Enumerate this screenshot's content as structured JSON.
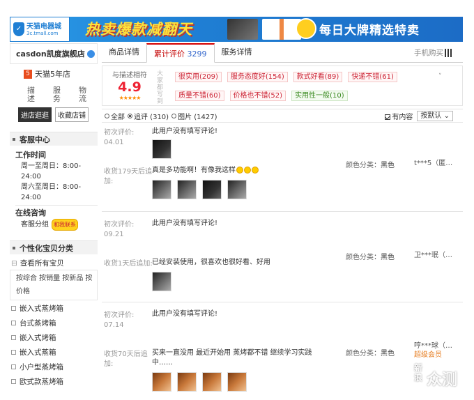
{
  "banner": {
    "logo_text": "天猫电器城",
    "logo_sub": "3c.tmall.com",
    "slogan": "热卖爆款减翻天",
    "right_text": "每日大牌精选特卖"
  },
  "sidebar": {
    "shop_name": "casdon凯度旗舰店",
    "years_badge": "5",
    "years_text": "天猫5年店",
    "ratings": [
      "描述",
      "服务",
      "物流"
    ],
    "btn_enter": "进店逛逛",
    "btn_fav": "收藏店铺",
    "service_header": "客服中心",
    "work_time_title": "工作时间",
    "weekday_hours": "周一至周日：8:00-24:00",
    "weekend_hours": "周六至周日：8:00-24:00",
    "online_title": "在线咨询",
    "service_group": "客服分组",
    "wangwang": "和我联系",
    "category_header": "个性化宝贝分类",
    "view_all": "查看所有宝贝",
    "sort_options": "按综合 按销量 按新品 按价格",
    "categories": [
      "嵌入式蒸烤箱",
      "台式蒸烤箱",
      "嵌入式烤箱",
      "嵌入式蒸箱",
      "小户型蒸烤箱",
      "欧式款蒸烤箱"
    ]
  },
  "tabs": {
    "detail": "商品详情",
    "reviews": "累计评价",
    "reviews_count": "3299",
    "service": "服务详情",
    "mobile": "手机购买"
  },
  "score": {
    "label": "与描述相符",
    "value": "4.9",
    "stars": "★★★★★",
    "big_label": "大家都写到",
    "tags": [
      {
        "text": "很实用(209)",
        "type": "red"
      },
      {
        "text": "服务态度好(154)",
        "type": "red"
      },
      {
        "text": "款式好看(89)",
        "type": "red"
      },
      {
        "text": "快递不错(61)",
        "type": "red"
      },
      {
        "text": "质量不错(60)",
        "type": "red"
      },
      {
        "text": "价格也不错(52)",
        "type": "red"
      },
      {
        "text": "实用性一般(10)",
        "type": "green"
      }
    ],
    "more_arrow": "˅"
  },
  "filter": {
    "all": "全部",
    "append": "追评 (310)",
    "pics": "图片 (1427)",
    "has_content": "有内容",
    "sort": "按默认"
  },
  "reviews": [
    {
      "initial_label": "初次评价:",
      "initial_date": "04.01",
      "initial_text": "此用户没有填写评论!",
      "append_label": "收货179天后追加:",
      "append_text": "真是多功能啊！有像我这样",
      "spec_key": "颜色分类",
      "spec_val": "黑色",
      "user": "t***5（匿…",
      "vip": ""
    },
    {
      "initial_label": "初次评价:",
      "initial_date": "09.21",
      "initial_text": "此用户没有填写评论!",
      "append_label": "收货1天后追加:",
      "append_text": "已经安装使用，很喜欢也很好看、好用",
      "spec_key": "颜色分类",
      "spec_val": "黑色",
      "user": "卫***珉（…",
      "vip": ""
    },
    {
      "initial_label": "初次评价:",
      "initial_date": "07.14",
      "initial_text": "此用户没有填写评论!",
      "append_label": "收货70天后追加:",
      "append_text": "买来一直没用 最近开始用 蒸烤都不错 继续学习实践中……",
      "spec_key": "颜色分类",
      "spec_val": "黑色",
      "user": "哼***球（…",
      "vip": "超级会员"
    }
  ],
  "watermark": {
    "n": "新浪",
    "z": "众测"
  }
}
